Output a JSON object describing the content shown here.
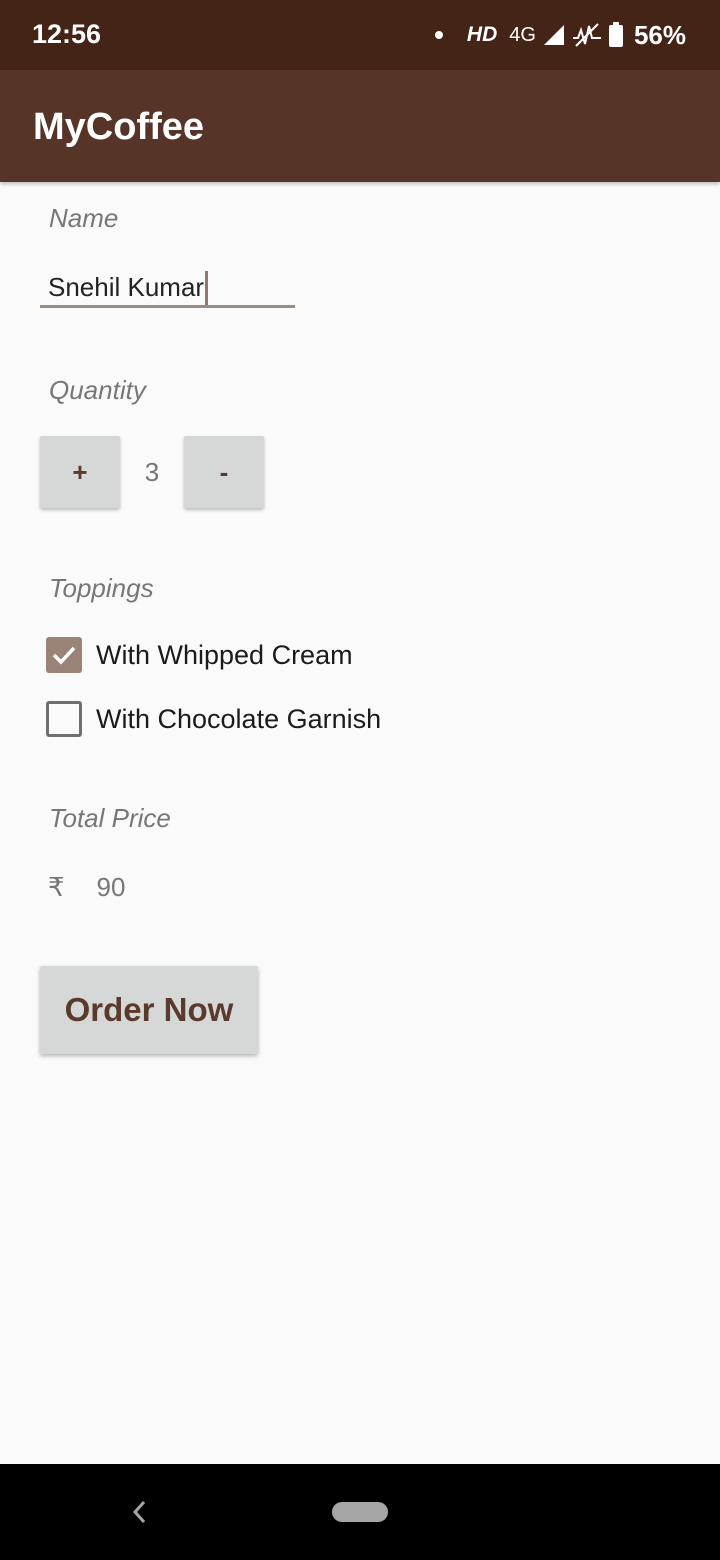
{
  "status_bar": {
    "time": "12:56",
    "hd": "HD",
    "network": "4G",
    "battery_percent": "56%"
  },
  "app_bar": {
    "title": "MyCoffee",
    "color": "#563427"
  },
  "form": {
    "name_label": "Name",
    "name_value": "Snehil Kumar",
    "quantity_label": "Quantity",
    "plus_label": "+",
    "quantity_value": "3",
    "minus_label": "-",
    "toppings_label": "Toppings",
    "toppings": [
      {
        "label": "With Whipped Cream",
        "checked": true
      },
      {
        "label": "With Chocolate Garnish",
        "checked": false
      }
    ],
    "total_price_label": "Total Price",
    "currency_symbol": "₹",
    "total_price_value": "90",
    "order_button_label": "Order Now"
  },
  "icons": {
    "status": [
      "signal-icon",
      "no-data-icon",
      "battery-icon"
    ],
    "nav": [
      "back-icon",
      "home-pill-icon"
    ]
  }
}
